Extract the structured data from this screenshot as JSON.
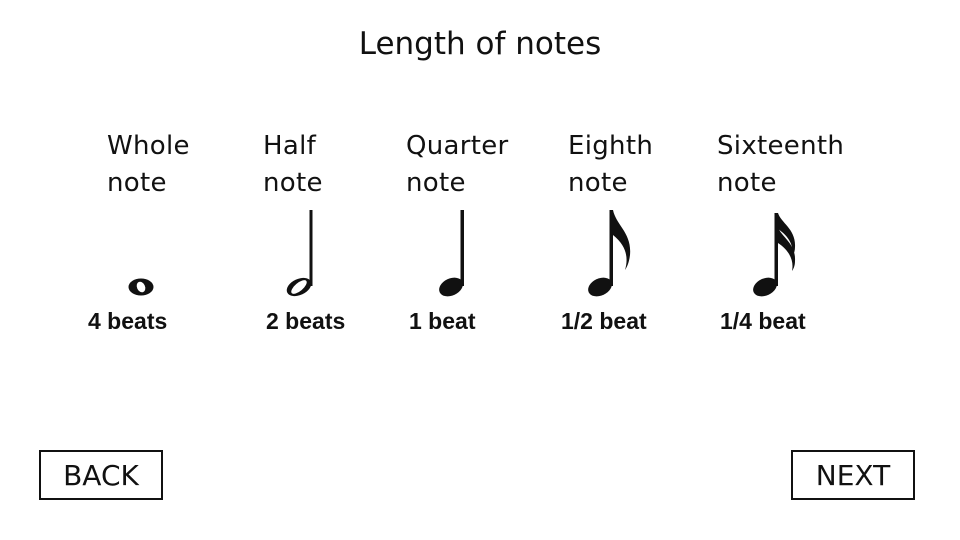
{
  "title": "Length of notes",
  "notes": [
    {
      "label_line1": "Whole",
      "label_line2": "note",
      "beats": "4 beats",
      "symbol": "whole-note-icon"
    },
    {
      "label_line1": "Half",
      "label_line2": "note",
      "beats": "2 beats",
      "symbol": "half-note-icon"
    },
    {
      "label_line1": "Quarter",
      "label_line2": "note",
      "beats": "1 beat",
      "symbol": "quarter-note-icon"
    },
    {
      "label_line1": "Eighth",
      "label_line2": "note",
      "beats": "1/2 beat",
      "symbol": "eighth-note-icon"
    },
    {
      "label_line1": "Sixteenth",
      "label_line2": "note",
      "beats": "1/4 beat",
      "symbol": "sixteenth-note-icon"
    }
  ],
  "buttons": {
    "back": "BACK",
    "next": "NEXT"
  }
}
